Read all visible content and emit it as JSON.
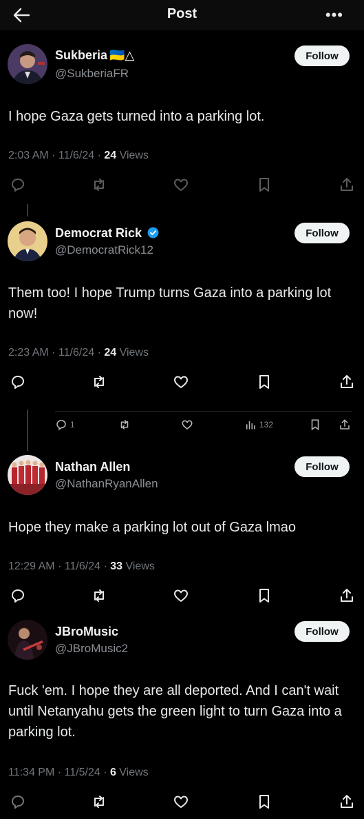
{
  "header": {
    "title": "Post"
  },
  "follow_label": "Follow",
  "posts": [
    {
      "name": "Sukberia",
      "badge": "🇺🇦△",
      "handle": "@SukberiaFR",
      "text": "I hope Gaza gets turned into a parking lot.",
      "time": "2:03 AM · 11/6/24 · ",
      "views": "24",
      "views_label": " Views"
    },
    {
      "name": "Democrat Rick",
      "handle": "@DemocratRick12",
      "text": "Them too! I hope Trump turns Gaza into a parking lot now!",
      "time": "2:23 AM · 11/6/24 · ",
      "views": "24",
      "views_label": " Views"
    },
    {
      "name": "Nathan Allen",
      "handle": "@NathanRyanAllen",
      "text": "Hope they make a parking lot out of Gaza lmao",
      "time": "12:29 AM · 11/6/24 · ",
      "views": "33",
      "views_label": " Views"
    },
    {
      "name": "JBroMusic",
      "handle": "@JBroMusic2",
      "text": "Fuck 'em.  I hope they are all deported.  And I can't wait until Netanyahu gets the green light to turn Gaza into a parking lot.",
      "time": "11:34 PM · 11/5/24 · ",
      "views": "6",
      "views_label": " Views"
    }
  ],
  "mini_stats": {
    "replies": "1",
    "views": "132"
  },
  "colors": {
    "background": "#000000",
    "verified": "#1d9bf0",
    "muted": "#71767b",
    "follow_bg": "#eff3f4"
  }
}
